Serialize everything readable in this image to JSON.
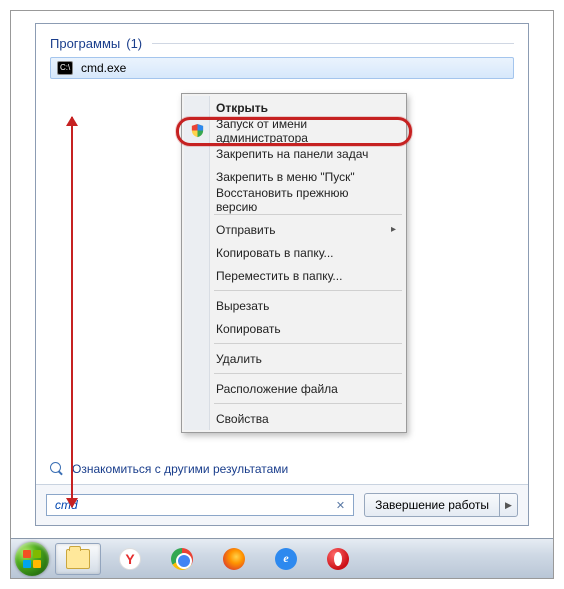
{
  "search": {
    "group_label": "Программы",
    "group_count": "(1)",
    "result_name": "cmd.exe",
    "more_results": "Ознакомиться с другими результатами",
    "input_value": "cmd",
    "shutdown_label": "Завершение работы"
  },
  "context_menu": {
    "open": "Открыть",
    "run_as_admin": "Запуск от имени администратора",
    "pin_taskbar": "Закрепить на панели задач",
    "pin_startmenu": "Закрепить в меню \"Пуск\"",
    "restore_prev": "Восстановить прежнюю версию",
    "send_to": "Отправить",
    "copy_to_folder": "Копировать в папку...",
    "move_to_folder": "Переместить в папку...",
    "cut": "Вырезать",
    "copy": "Копировать",
    "delete": "Удалить",
    "open_location": "Расположение файла",
    "properties": "Свойства"
  },
  "icons": {
    "yandex_letter": "Y",
    "ie_letter": "e"
  }
}
